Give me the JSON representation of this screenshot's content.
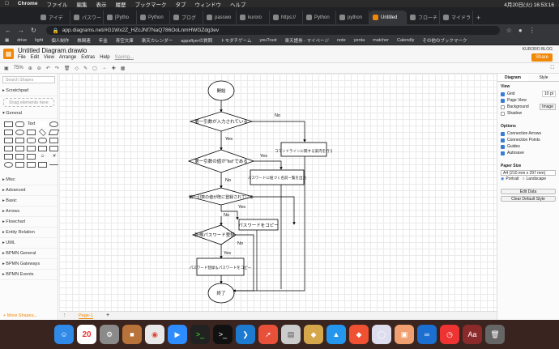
{
  "menubar": {
    "app": "Chrome",
    "items": [
      "ファイル",
      "編集",
      "表示",
      "履歴",
      "ブックマーク",
      "タブ",
      "ウィンドウ",
      "ヘルプ"
    ],
    "clock": "4月20日(火) 16:53:16"
  },
  "tabs": [
    "アイデ",
    "パスワー",
    "[Pytho",
    "Python",
    "ブログ",
    "passwo",
    "kuroro",
    "https://",
    "Python",
    "python",
    "Untitled",
    "フローチ",
    "マイドラ"
  ],
  "address": {
    "url": "app.diagrams.net/#G1Wx2Z_HZcJNf7NaQ786OoLnmHWGZdg3ev"
  },
  "bookmarks": [
    "drive",
    "light",
    "個人制作",
    "株関連",
    "年金",
    "青空文庫",
    "楽天カレンダー",
    "appsflyerの質問",
    "トモダチゲーム",
    "youTrust",
    "楽天證券 - マイページ",
    "note",
    "yenta",
    "matcher",
    "Calendly",
    "その他のブックマーク"
  ],
  "app": {
    "title": "Untitled Diagram.drawio",
    "menus": [
      "File",
      "Edit",
      "View",
      "Arrange",
      "Extras",
      "Help"
    ],
    "saving": "Saving...",
    "brand": "KURORO BLOG",
    "share": "Share",
    "zoom": "75%"
  },
  "left": {
    "search": "Search Shapes",
    "scratchpad": "Scratchpad",
    "drop": "Drag elements here",
    "general": "General",
    "cats": [
      "Misc",
      "Advanced",
      "Basic",
      "Arrows",
      "Flowchart",
      "Entity Relation",
      "UML",
      "BPMN General",
      "BPMN Gateways",
      "BPMN Events"
    ],
    "more": "+ More Shapes..."
  },
  "page": {
    "tab": "Page-1"
  },
  "right": {
    "tabs": [
      "Diagram",
      "Style"
    ],
    "view": "View",
    "grid": "Grid",
    "grid_size": "10 pt",
    "page_view": "Page View",
    "background": "Background",
    "image_btn": "Image",
    "shadow": "Shadow",
    "options": "Options",
    "opts": [
      "Connection Arrows",
      "Connection Points",
      "Guides",
      "Autosave"
    ],
    "paper": "Paper Size",
    "paper_value": "A4 (210 mm x 297 mm)",
    "portrait": "Portrait",
    "landscape": "Landscape",
    "edit": "Edit Data",
    "clear": "Clear Default Style"
  },
  "flow": {
    "start": "開始",
    "d1": "第一引数が入力されている",
    "no1": "No",
    "n1": "コマンドラインに関する案内を行う",
    "d2": "第一引数の値が\"list\"である",
    "yes1": "Yes",
    "yes2": "Yes",
    "n2": "パスワードに紐づく名前一覧を出力",
    "no2": "No",
    "d3": "第一引数の値が既に登録されている",
    "yes3": "Yes",
    "no3": "No",
    "n3": "パスワードをコピー",
    "d4": "新規パスワード登録",
    "no4": "No",
    "yes4": "Yes",
    "n4": "パスワード登録＆パスワードをコピー",
    "end": "終了"
  },
  "dock": [
    "Finder",
    "Calendar 20",
    "Prefs",
    "Files",
    "Chrome",
    "Zoom",
    "Terminal",
    "Terminal",
    "VS Code",
    "Safari",
    "Script",
    "Store",
    "Docker",
    "Git",
    "Files",
    "Photos",
    "Infinity",
    "Clock",
    "Dictionary",
    "Trash"
  ]
}
